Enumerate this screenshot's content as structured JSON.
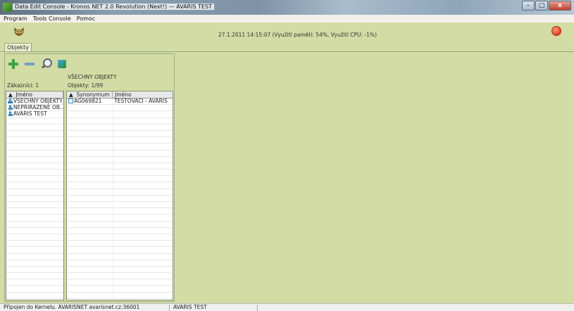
{
  "window": {
    "title": "Data Edit Console - Kronos NET 2.0 Revolution (Next!) — AVARIS TEST",
    "controls": {
      "minimize": "–",
      "maximize": "□",
      "close": "x"
    }
  },
  "menu": {
    "items": [
      "Program",
      "Tools Console",
      "Pomoc"
    ]
  },
  "header": {
    "status": "27.1.2011 14:15:07 (Využití paměti: 54%, Využití CPU: -1%)"
  },
  "tabs": [
    {
      "label": "Objekty"
    }
  ],
  "left": {
    "customers_label": "Zákazníci: 1",
    "customers_header": "Jméno",
    "customers": [
      {
        "name": "VŠECHNY OBJEKTY",
        "icon": "group-icon"
      },
      {
        "name": "NEPŘIŘAZENÉ OB...",
        "icon": "user-icon"
      },
      {
        "name": "AVARIS TEST",
        "icon": "user-icon"
      }
    ],
    "selected_group": "VŠECHNY OBJEKTY",
    "objects_label": "Objekty: 1/99",
    "objects_headers": [
      "Synonymum",
      "Jméno"
    ],
    "objects": [
      {
        "synonym": "AG069821",
        "name": "TESTOVACÍ - AVARIS",
        "icon": "house-icon"
      }
    ]
  },
  "statusbar": {
    "connection": "Připojen do Kernelu. AVARISNET avarisnet.cz:36001",
    "customer": "AVARIS TEST"
  }
}
